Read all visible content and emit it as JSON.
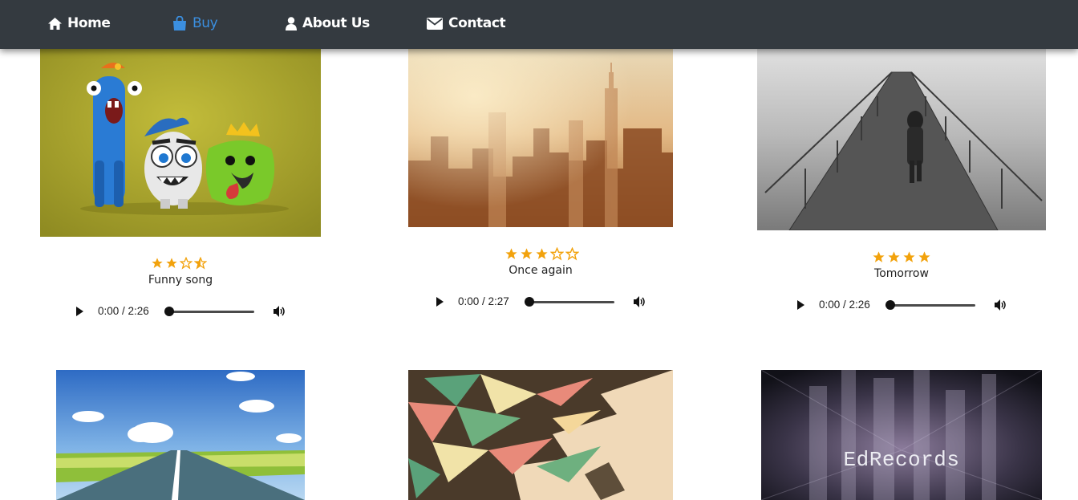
{
  "nav": {
    "items": [
      {
        "label": "Home",
        "icon": "home-icon"
      },
      {
        "label": "Buy",
        "icon": "shopping-bag-icon",
        "active": true
      },
      {
        "label": "About Us",
        "icon": "user-icon"
      },
      {
        "label": "Contact",
        "icon": "envelope-icon"
      }
    ],
    "colors": {
      "background": "#343a40",
      "text": "#ffffff",
      "active": "#3b8fe0"
    }
  },
  "cards": [
    {
      "title": "Funny song",
      "rating": 3.5,
      "time": "0:00 / 2:26",
      "image": "cartoon-monsters"
    },
    {
      "title": "Once again",
      "rating": 3,
      "time": "0:00 / 2:27",
      "image": "city-skyline"
    },
    {
      "title": "Tomorrow",
      "rating": 4,
      "time": "0:00 / 2:26",
      "image": "man-on-pier"
    },
    {
      "image": "open-road"
    },
    {
      "image": "geometric-trumpet"
    },
    {
      "image": "edrecords-city",
      "overlay_text": "EdRecords"
    }
  ],
  "star_color": "#f2a20c"
}
